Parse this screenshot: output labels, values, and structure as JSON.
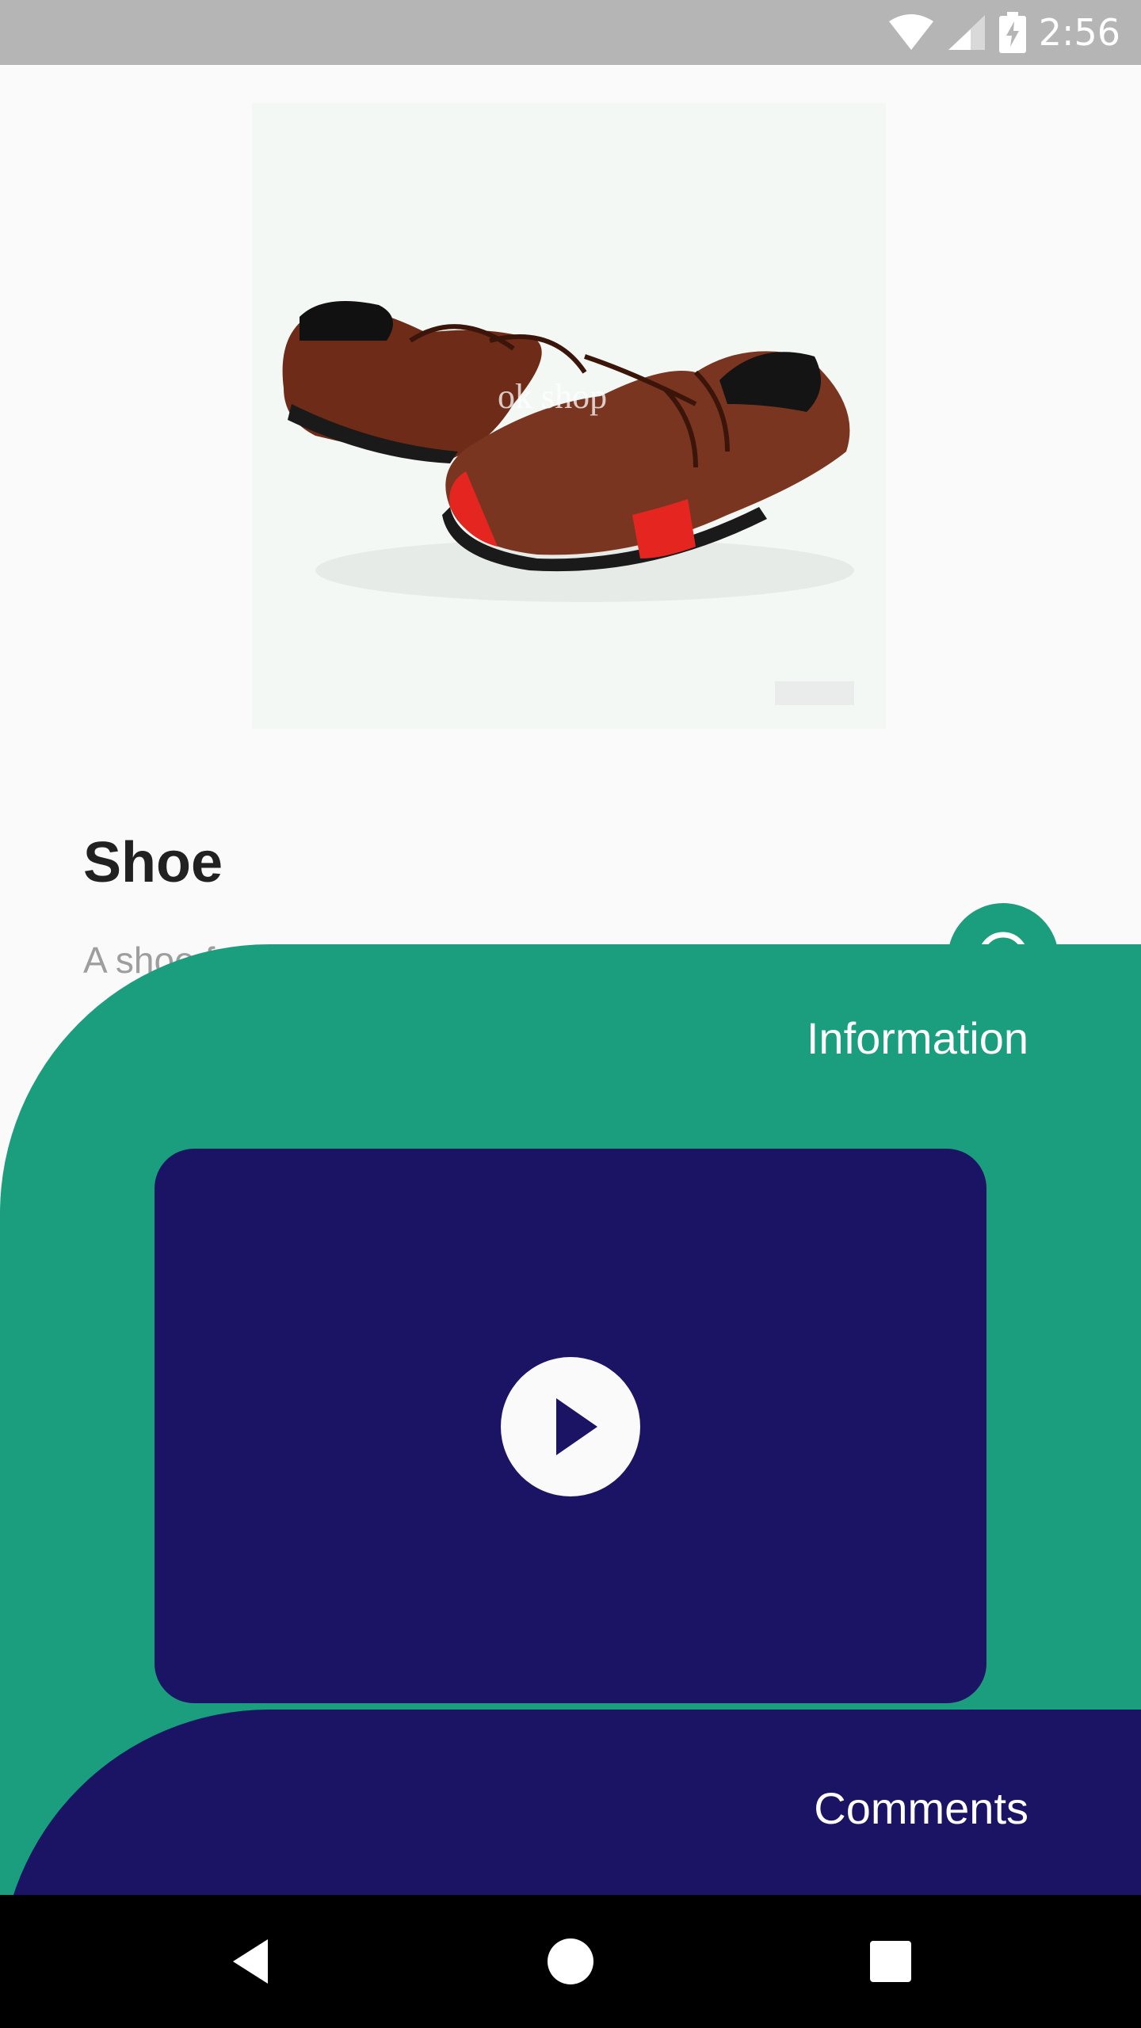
{
  "status_bar": {
    "time": "2:56",
    "icons": [
      "wifi-icon",
      "signal-icon",
      "battery-charging-icon"
    ]
  },
  "product": {
    "image_watermark": "ok shop",
    "title": "Shoe",
    "description": "A shoe f"
  },
  "fab": {
    "icon": "chat-icon"
  },
  "info_sheet": {
    "title": "Information",
    "video": {
      "play_icon": "play-icon"
    }
  },
  "comments_sheet": {
    "title": "Comments"
  },
  "nav_bar": {
    "buttons": [
      "back-icon",
      "home-icon",
      "recents-icon"
    ]
  },
  "colors": {
    "status_bar": "#b5b5b5",
    "background": "#fafafa",
    "accent_green": "#1a9e7e",
    "navy": "#1b1464",
    "title_text": "#212121",
    "desc_text": "#9e9e9e",
    "shoe_leather": "#7a3520",
    "shoe_red": "#e52620"
  }
}
